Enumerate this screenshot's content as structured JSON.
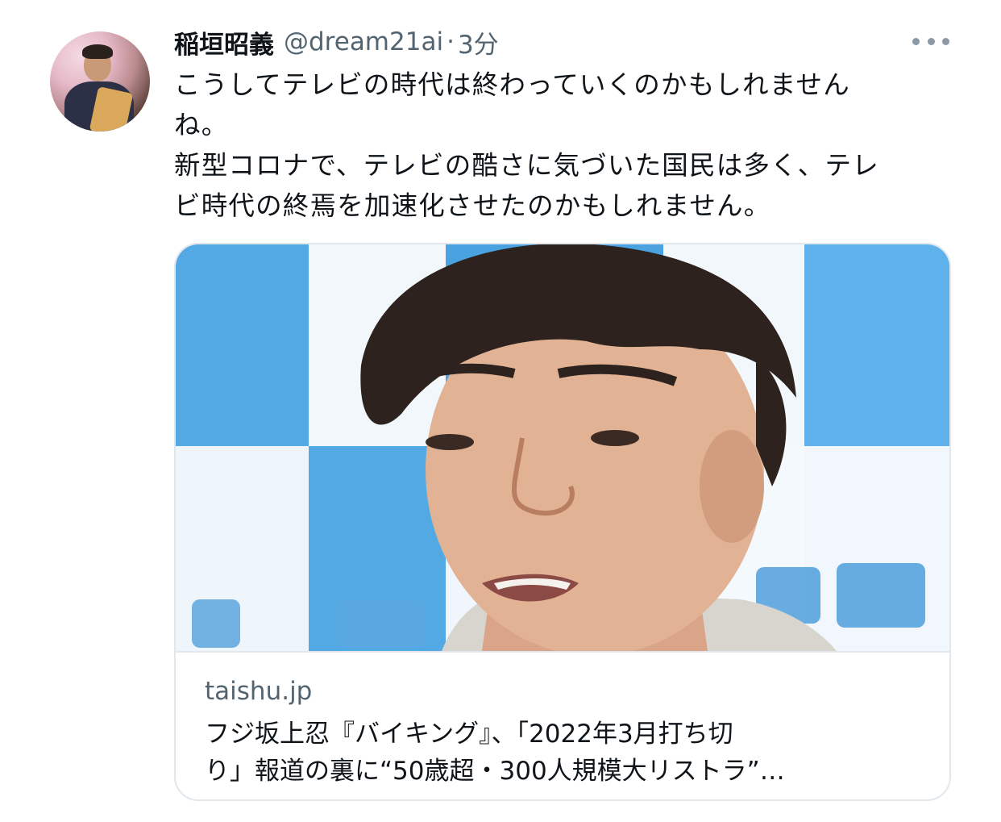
{
  "tweet": {
    "display_name": "稲垣昭義",
    "handle": "@dream21ai",
    "separator": "·",
    "time": "3分",
    "text_lines": [
      "こうしてテレビの時代は終わっていくのかもしれません",
      "ね。",
      "新型コロナで、テレビの酷さに気づいた国民は多く、テレ",
      "ビ時代の終焉を加速化させたのかもしれません。"
    ]
  },
  "card": {
    "domain": "taishu.jp",
    "title_lines": [
      "フジ坂上忍『バイキング』、「2022年3月打ち切",
      "り」報道の裏に“50歳超・300人規模大リストラ”…"
    ]
  },
  "icons": {
    "more": "more-horizontal-icon"
  },
  "colors": {
    "text": "#0f1419",
    "secondary": "#536471",
    "border": "#e1e8ed",
    "backdrop_blue": "#4ba7e6"
  }
}
